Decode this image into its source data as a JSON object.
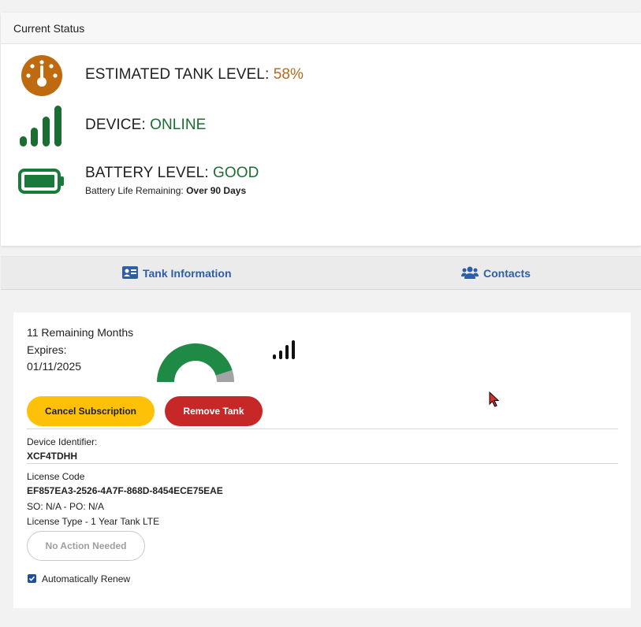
{
  "status": {
    "header": "Current Status",
    "tank": {
      "label": "ESTIMATED TANK LEVEL: ",
      "value": "58%",
      "icon": "gauge-icon",
      "color": "#c06a10"
    },
    "device": {
      "label": "DEVICE: ",
      "value": "ONLINE",
      "icon": "signal-bars-icon",
      "color": "#1a6e32"
    },
    "battery": {
      "label": "BATTERY LEVEL: ",
      "value": "GOOD",
      "icon": "battery-icon",
      "color": "#1a7a3c",
      "sub_label": "Battery Life Remaining: ",
      "sub_value": "Over 90 Days"
    }
  },
  "tabs": [
    {
      "label": "Tank Information",
      "icon": "id-card-icon"
    },
    {
      "label": "Contacts",
      "icon": "users-icon"
    }
  ],
  "subscription": {
    "remaining": "11 Remaining Months",
    "expires_label": "Expires:",
    "expires_date": "01/11/2025",
    "gauge_fraction": 0.9,
    "cancel_label": "Cancel Subscription",
    "remove_label": "Remove Tank",
    "device_id_label": "Device Identifier:",
    "device_id": "XCF4TDHH",
    "license_label": "License Code",
    "license_code": "EF857EA3-2526-4A7F-868D-8454ECE75EAE",
    "so_po": "SO: N/A - PO: N/A",
    "license_type": "License Type - 1 Year Tank LTE",
    "no_action_label": "No Action Needed",
    "auto_renew_label": "Automatically Renew",
    "auto_renew": true
  }
}
